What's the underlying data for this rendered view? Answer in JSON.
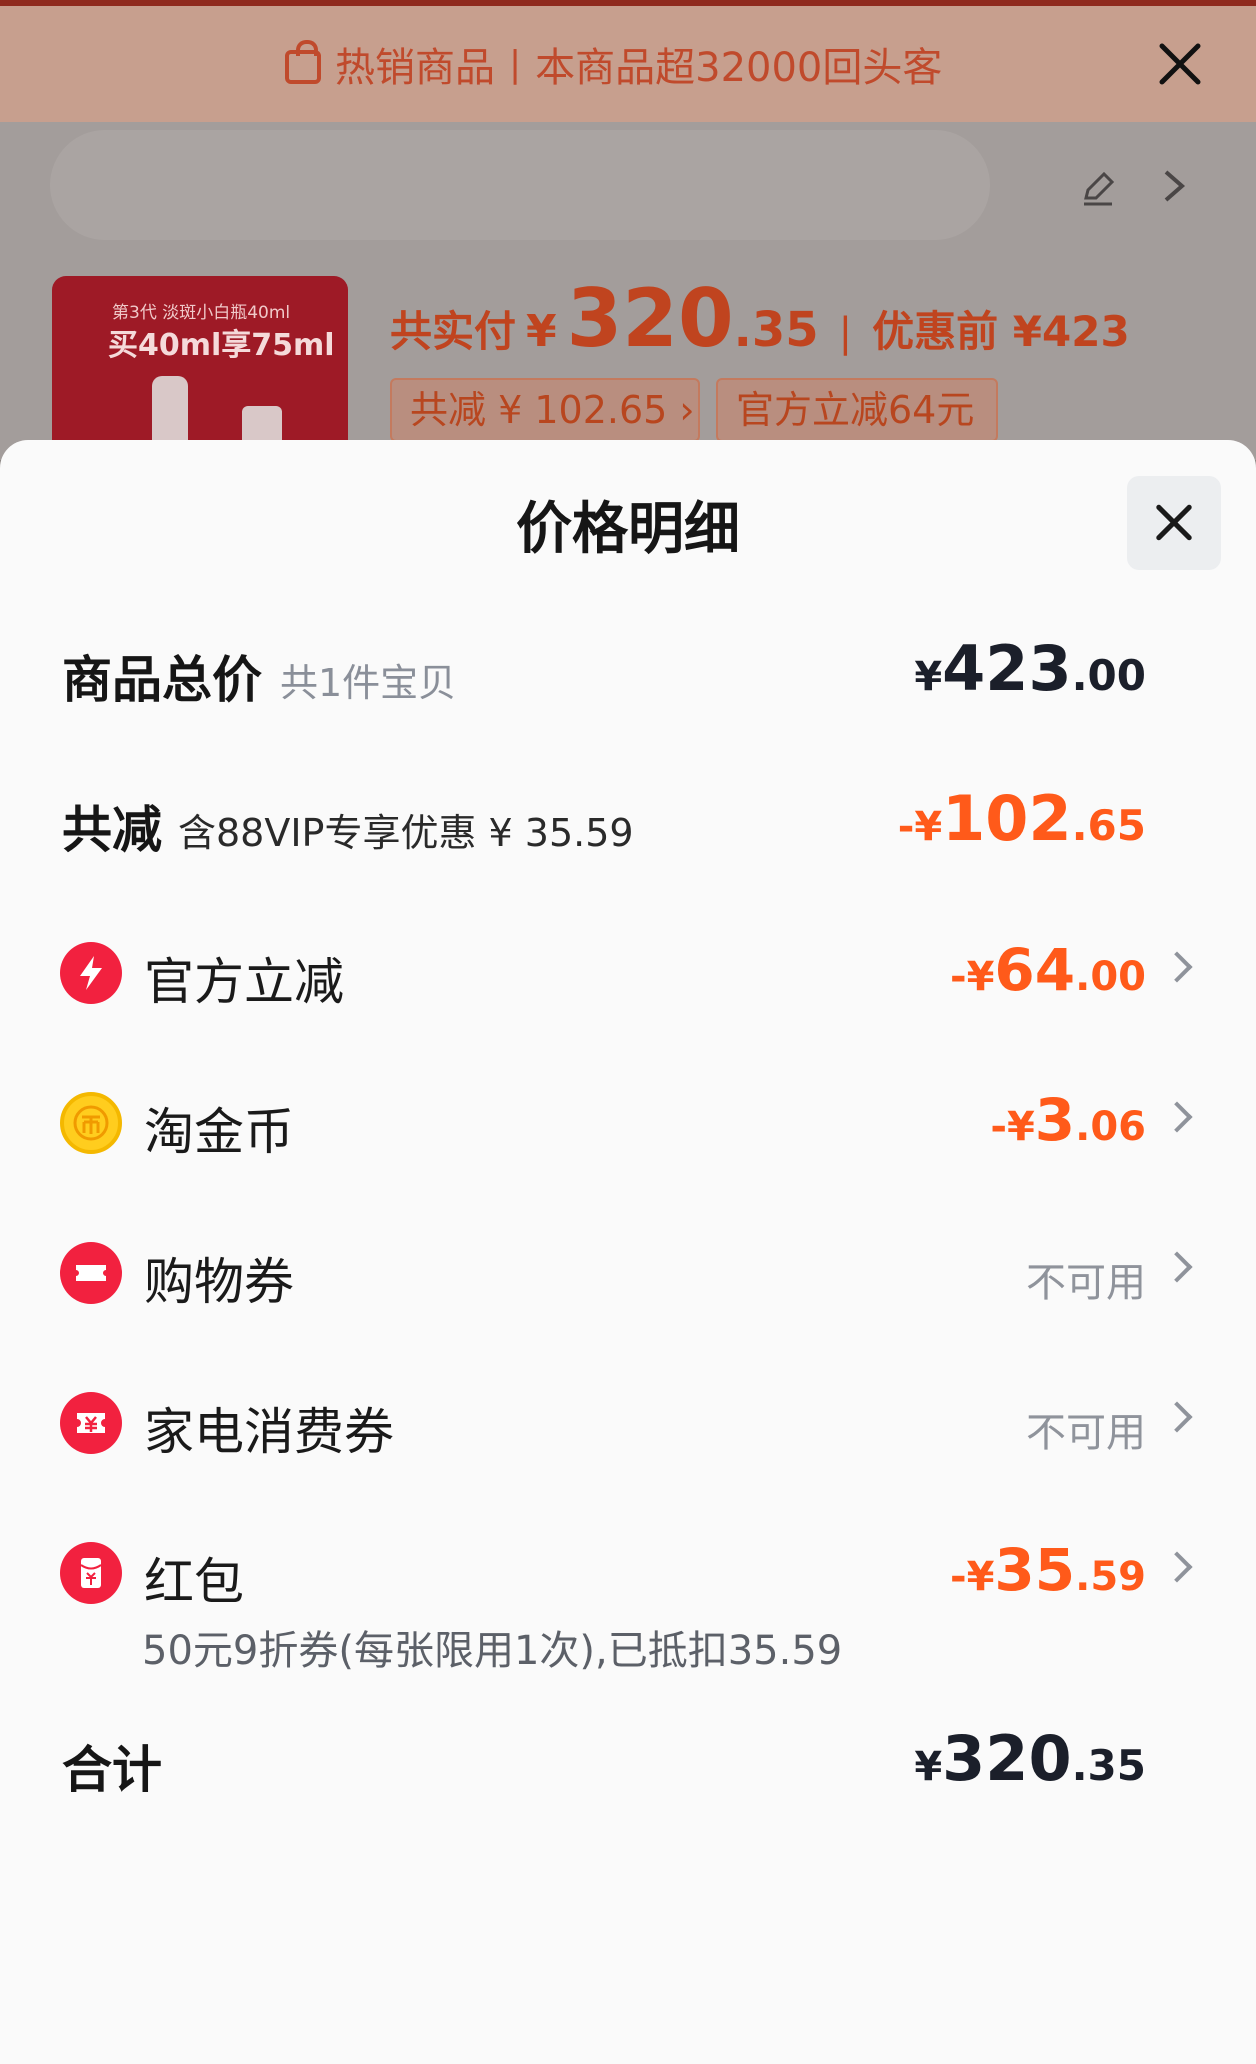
{
  "background": {
    "banner_title": "热销商品",
    "banner_subtitle": "本商品超32000回头客",
    "price_label": "共实付",
    "price_currency": "¥",
    "price_int": "320",
    "price_dec": ".35",
    "before_label": "优惠前 ¥423",
    "chip_discount": "共减 ¥ 102.65 ›",
    "chip_official": "官方立减64元",
    "thumb_line1": "第3代 淡斑小白瓶40ml",
    "thumb_line2": "买40ml享75ml"
  },
  "sheet": {
    "title": "价格明细",
    "total_goods": {
      "label": "商品总价",
      "sub": "共1件宝贝",
      "cur": "¥",
      "int": "423",
      "dec": ".00"
    },
    "total_discount": {
      "label": "共减",
      "sub": "含88VIP专享优惠 ¥ 35.59",
      "cur": "-¥",
      "int": "102",
      "dec": ".65"
    },
    "items": [
      {
        "label": "官方立减",
        "icon": "lightning-icon",
        "cur": "-¥",
        "int": "64",
        "dec": ".00"
      },
      {
        "label": "淘金币",
        "icon": "coin-icon",
        "cur": "-¥",
        "int": "3",
        "dec": ".06"
      },
      {
        "label": "购物券",
        "icon": "ticket-icon",
        "status": "不可用"
      },
      {
        "label": "家电消费券",
        "icon": "appliance-coupon-icon",
        "status": "不可用"
      },
      {
        "label": "红包",
        "icon": "red-envelope-icon",
        "cur": "-¥",
        "int": "35",
        "dec": ".59",
        "note": "50元9折券(每张限用1次),已抵扣35.59"
      }
    ],
    "grand_total": {
      "label": "合计",
      "cur": "¥",
      "int": "320",
      "dec": ".35"
    }
  },
  "colors": {
    "accent_orange": "#ff5a1a",
    "icon_red": "#f2213f",
    "icon_gold": "#ffcd1e"
  }
}
